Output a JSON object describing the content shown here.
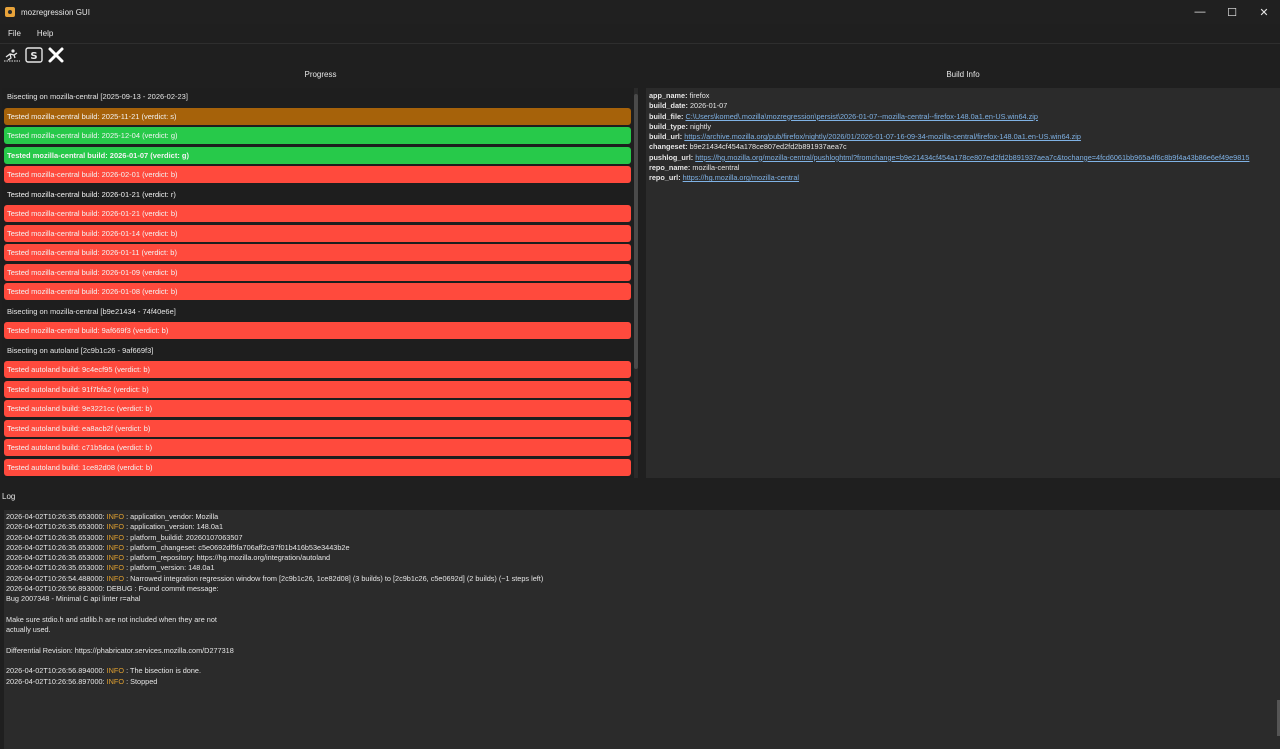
{
  "window": {
    "title": "mozregression GUI",
    "minimize": "—",
    "maximize": "☐",
    "close": "✕"
  },
  "menu": {
    "file": "File",
    "help": "Help"
  },
  "toolbar": {
    "icons": [
      "run-icon",
      "single-run-icon",
      "stop-icon"
    ]
  },
  "progress": {
    "header": "Progress",
    "rows": [
      {
        "text": "Bisecting on mozilla-central [2025-09-13 - 2026-02-23]",
        "kind": "header"
      },
      {
        "text": "Tested mozilla-central build: 2025-11-21 (verdict: s)",
        "kind": "s"
      },
      {
        "text": "Tested mozilla-central build: 2025-12-04 (verdict: g)",
        "kind": "g"
      },
      {
        "text": "Tested mozilla-central build: 2026-01-07 (verdict: g)",
        "kind": "g",
        "bold": true
      },
      {
        "text": "Tested mozilla-central build: 2026-02-01 (verdict: b)",
        "kind": "b"
      },
      {
        "text": "Tested mozilla-central build: 2026-01-21 (verdict: r)",
        "kind": "r"
      },
      {
        "text": "Tested mozilla-central build: 2026-01-21 (verdict: b)",
        "kind": "b"
      },
      {
        "text": "Tested mozilla-central build: 2026-01-14 (verdict: b)",
        "kind": "b"
      },
      {
        "text": "Tested mozilla-central build: 2026-01-11 (verdict: b)",
        "kind": "b"
      },
      {
        "text": "Tested mozilla-central build: 2026-01-09 (verdict: b)",
        "kind": "b"
      },
      {
        "text": "Tested mozilla-central build: 2026-01-08 (verdict: b)",
        "kind": "b"
      },
      {
        "text": "Bisecting on mozilla-central [b9e21434 - 74f40e6e]",
        "kind": "header"
      },
      {
        "text": "Tested mozilla-central build: 9af669f3 (verdict: b)",
        "kind": "b"
      },
      {
        "text": "Bisecting on autoland [2c9b1c26 - 9af669f3]",
        "kind": "header"
      },
      {
        "text": "Tested autoland build: 9c4ecf95 (verdict: b)",
        "kind": "b"
      },
      {
        "text": "Tested autoland build: 91f7bfa2 (verdict: b)",
        "kind": "b"
      },
      {
        "text": "Tested autoland build: 9e3221cc (verdict: b)",
        "kind": "b"
      },
      {
        "text": "Tested autoland build: ea8acb2f (verdict: b)",
        "kind": "b"
      },
      {
        "text": "Tested autoland build: c71b5dca (verdict: b)",
        "kind": "b"
      },
      {
        "text": "Tested autoland build: 1ce82d08 (verdict: b)",
        "kind": "b"
      },
      {
        "text": "",
        "kind": "b"
      }
    ]
  },
  "build_info": {
    "header": "Build Info",
    "items": [
      {
        "key": "app_name:",
        "value": "firefox",
        "link": false
      },
      {
        "key": "build_date:",
        "value": "2026-01-07",
        "link": false
      },
      {
        "key": "build_file:",
        "value": "C:\\Users\\komed\\.mozilla\\mozregression\\persist\\2026-01-07--mozilla-central--firefox-148.0a1.en-US.win64.zip",
        "link": true
      },
      {
        "key": "build_type:",
        "value": "nightly",
        "link": false
      },
      {
        "key": "build_url:",
        "value": "https://archive.mozilla.org/pub/firefox/nightly/2026/01/2026-01-07-16-09-34-mozilla-central/firefox-148.0a1.en-US.win64.zip",
        "link": true
      },
      {
        "key": "changeset:",
        "value": "b9e21434cf454a178ce807ed2fd2b891937aea7c",
        "link": false
      },
      {
        "key": "pushlog_url:",
        "value": "https://hg.mozilla.org/mozilla-central/pushloghtml?fromchange=b9e21434cf454a178ce807ed2fd2b891937aea7c&tochange=4fcd6061bb965a4f6c8b9f4a43b86e6ef49e9815",
        "link": true
      },
      {
        "key": "repo_name:",
        "value": "mozilla-central",
        "link": false
      },
      {
        "key": "repo_url:",
        "value": "https://hg.mozilla.org/mozilla-central",
        "link": true
      }
    ]
  },
  "log": {
    "label": "Log",
    "lines": [
      {
        "ts": "2026-04-02T10:26:35.653000:",
        "lvl": "INFO",
        "msg": ": application_vendor: Mozilla"
      },
      {
        "ts": "2026-04-02T10:26:35.653000:",
        "lvl": "INFO",
        "msg": ": application_version: 148.0a1"
      },
      {
        "ts": "2026-04-02T10:26:35.653000:",
        "lvl": "INFO",
        "msg": ": platform_buildid: 20260107063507"
      },
      {
        "ts": "2026-04-02T10:26:35.653000:",
        "lvl": "INFO",
        "msg": ": platform_changeset: c5e0692df5fa706aff2c97f01b416b53e3443b2e"
      },
      {
        "ts": "2026-04-02T10:26:35.653000:",
        "lvl": "INFO",
        "msg": ": platform_repository: https://hg.mozilla.org/integration/autoland"
      },
      {
        "ts": "2026-04-02T10:26:35.653000:",
        "lvl": "INFO",
        "msg": ": platform_version: 148.0a1"
      },
      {
        "ts": "2026-04-02T10:26:54.488000:",
        "lvl": "INFO",
        "msg": ": Narrowed integration regression window from [2c9b1c26, 1ce82d08] (3 builds) to [2c9b1c26, c5e0692d] (2 builds) (~1 steps left)"
      },
      {
        "ts": "",
        "lvl": "",
        "msg": "2026-04-02T10:26:56.893000: DEBUG : Found commit message:"
      },
      {
        "ts": "",
        "lvl": "",
        "msg": "Bug 2007348 - Minimal C api linter r=ahal"
      },
      {
        "ts": "",
        "lvl": "",
        "msg": ""
      },
      {
        "ts": "",
        "lvl": "",
        "msg": "Make sure stdio.h and stdlib.h are not included when they are not"
      },
      {
        "ts": "",
        "lvl": "",
        "msg": "actually used."
      },
      {
        "ts": "",
        "lvl": "",
        "msg": ""
      },
      {
        "ts": "",
        "lvl": "",
        "msg": "Differential Revision: https://phabricator.services.mozilla.com/D277318"
      },
      {
        "ts": "",
        "lvl": "",
        "msg": ""
      },
      {
        "ts": "2026-04-02T10:26:56.894000:",
        "lvl": "INFO",
        "msg": ": The bisection is done."
      },
      {
        "ts": "2026-04-02T10:26:56.897000:",
        "lvl": "INFO",
        "msg": ": Stopped"
      }
    ]
  },
  "colors": {
    "bad": "#ff4a3d",
    "good": "#27c94a",
    "skip": "#a6620a",
    "info": "#e0a030",
    "link": "#7fb2e5"
  }
}
